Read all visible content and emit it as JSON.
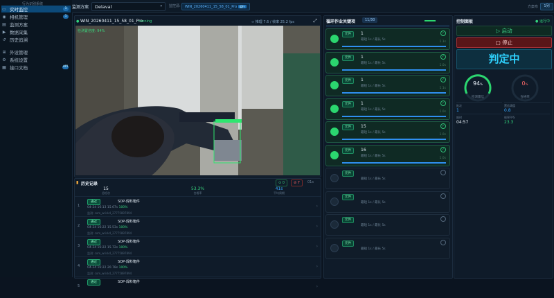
{
  "app": {
    "title": "行为识别系统"
  },
  "sidebar": {
    "items": [
      {
        "label": "实时监控",
        "icon": "monitor-icon",
        "badge": "1",
        "active": true
      },
      {
        "label": "相机管理",
        "icon": "camera-icon",
        "badge": "1"
      },
      {
        "label": "监测方案",
        "icon": "file-icon",
        "badge": ""
      },
      {
        "label": "数据采集",
        "icon": "video-icon",
        "badge": ""
      },
      {
        "label": "历史追溯",
        "icon": "history-icon",
        "badge": ""
      },
      {
        "label": "外设管理",
        "icon": "plug-icon",
        "badge": ""
      },
      {
        "label": "系统设置",
        "icon": "gear-icon",
        "badge": ""
      },
      {
        "label": "接口文档",
        "icon": "doc-icon",
        "badge": "API"
      }
    ]
  },
  "topbar": {
    "scheme_label": "监测方案",
    "scheme_value": "Delaval",
    "channel_label": "监控源:",
    "channel_value": "WIN_20260411_15_58_01_Pro",
    "channel_tag": "运行",
    "view_label": "方案布",
    "view_btn": "1列"
  },
  "video": {
    "title": "WIN_20260411_15_58_01_Pro",
    "status": "running",
    "stats": "∞ 推理 7.6 / 帧率 25.2 fps",
    "overlay": "检测置信度: 94%"
  },
  "history": {
    "title": "历史记录",
    "ok_count": "0",
    "ng_count": "7",
    "filter": "01s",
    "summary": [
      {
        "value": "15",
        "label": "总检次"
      },
      {
        "value": "53.3%",
        "label": "合格率"
      },
      {
        "value": "41s",
        "label": "平均周期"
      }
    ],
    "rows": [
      {
        "n": "1",
        "status": "通过",
        "title": "SOP-焊料箱件",
        "meta": "04-24 16:13 15.67s",
        "pct": "100%",
        "path": "监测: com_wrisk4_27775897894"
      },
      {
        "n": "2",
        "status": "通过",
        "title": "SOP-焊料箱件",
        "meta": "04-24 16:22 15.53s",
        "pct": "100%",
        "path": "监测: com_wrisk4_27775897894"
      },
      {
        "n": "3",
        "status": "通过",
        "title": "SOP-焊料箱件",
        "meta": "04-24 16:22 15.72s",
        "pct": "100%",
        "path": "监测: com_wrisk4_27775897894"
      },
      {
        "n": "4",
        "status": "通过",
        "title": "SOP-焊料箱件",
        "meta": "04-24 16:22 20.78s",
        "pct": "100%",
        "path": "监测: com_wrisk4_27775897894"
      },
      {
        "n": "5",
        "status": "通过",
        "title": "SOP-焊料箱件",
        "meta": "",
        "pct": "",
        "path": ""
      }
    ]
  },
  "checklist": {
    "title": "循环作业关键项",
    "count": "11/30",
    "items": [
      {
        "tag": "元件",
        "name": "1",
        "sub": "最短 1s / 最长 5s",
        "dur": "1.1s",
        "progress": 1,
        "done": true
      },
      {
        "tag": "元件",
        "name": "1",
        "sub": "最短 1s / 最长 5s",
        "dur": "1.0s",
        "progress": 1,
        "done": true
      },
      {
        "tag": "元件",
        "name": "1",
        "sub": "最短 1s / 最长 5s",
        "dur": "1.1s",
        "progress": 1,
        "done": true
      },
      {
        "tag": "元件",
        "name": "1",
        "sub": "最短 1s / 最长 5s",
        "dur": "1.0s",
        "progress": 1,
        "done": true
      },
      {
        "tag": "元件",
        "name": "15",
        "sub": "最短 1s / 最长 5s",
        "dur": "1.0s",
        "progress": 1,
        "done": true
      },
      {
        "tag": "元件",
        "name": "16",
        "sub": "最短 1s / 最长 5s",
        "dur": "1.0s",
        "progress": 1,
        "done": true
      },
      {
        "tag": "元件",
        "name": "",
        "sub": "最短 1s / 最长 5s",
        "dur": "",
        "progress": 0,
        "done": false
      },
      {
        "tag": "元件",
        "name": "",
        "sub": "最短 1s / 最长 5s",
        "dur": "",
        "progress": 0,
        "done": false
      },
      {
        "tag": "元件",
        "name": "",
        "sub": "最短 1s / 最长 5s",
        "dur": "",
        "progress": 0,
        "done": false
      },
      {
        "tag": "元件",
        "name": "",
        "sub": "最短 1s / 最长 5s",
        "dur": "",
        "progress": 0,
        "done": false
      }
    ]
  },
  "control": {
    "title": "控制面板",
    "status": "运行中",
    "start": "启动",
    "stop": "停止",
    "verdict": "判定中",
    "gauge1": {
      "value": "94",
      "unit": "%",
      "label": "检测置信"
    },
    "gauge2": {
      "value": "0",
      "unit": "%",
      "label": "合格率"
    },
    "kv": [
      {
        "k": "批次",
        "v": "1"
      },
      {
        "k": "置信阈值",
        "v": "0.8"
      },
      {
        "k": "耗时",
        "v": "04:57"
      },
      {
        "k": "帧率FPS",
        "v": "23.3"
      }
    ]
  }
}
